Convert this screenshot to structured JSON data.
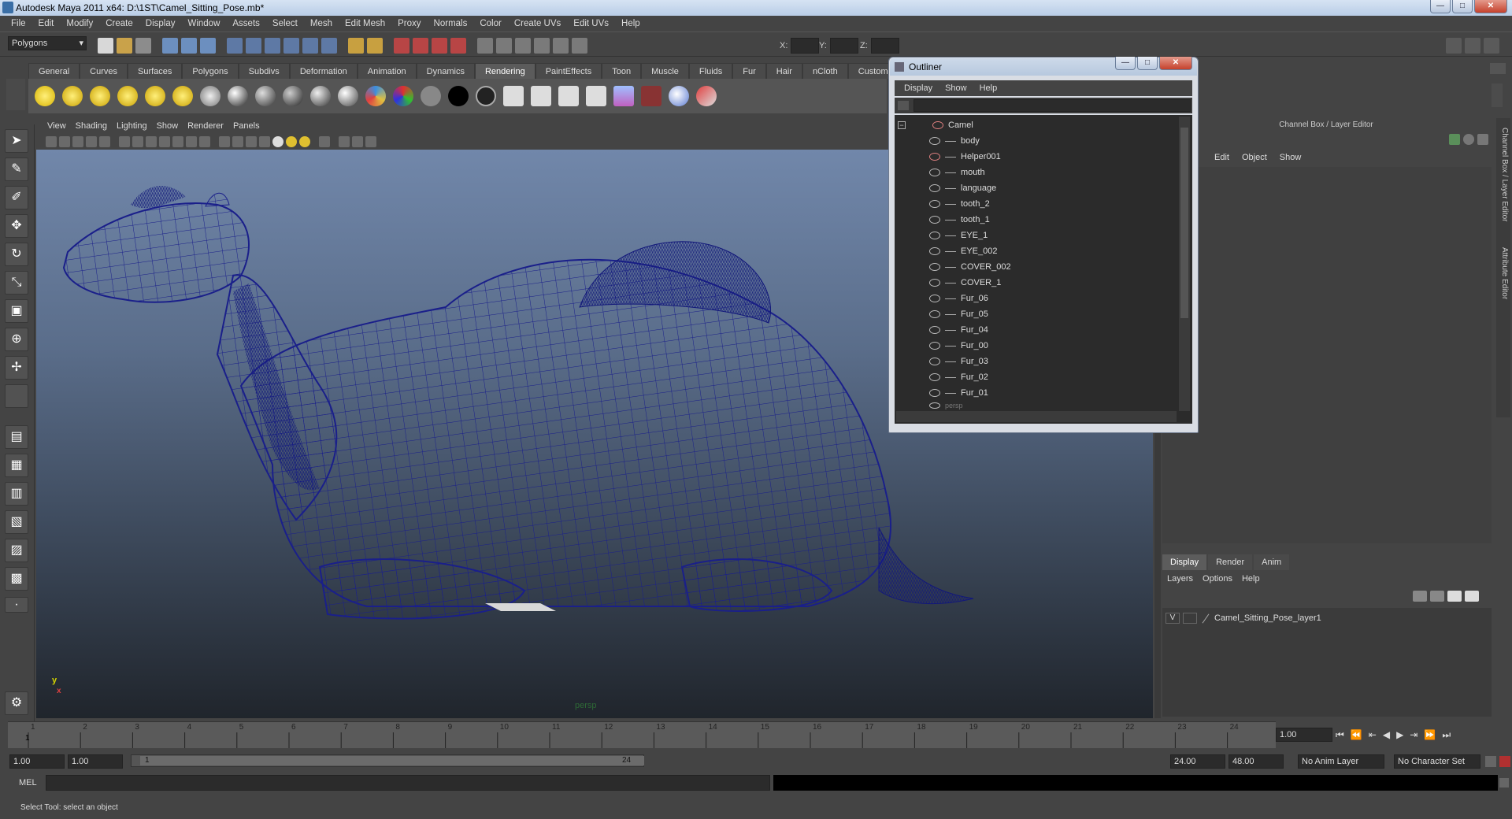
{
  "window": {
    "title": "Autodesk Maya 2011 x64: D:\\1ST\\Camel_Sitting_Pose.mb*"
  },
  "menus": [
    "File",
    "Edit",
    "Modify",
    "Create",
    "Display",
    "Window",
    "Assets",
    "Select",
    "Mesh",
    "Edit Mesh",
    "Proxy",
    "Normals",
    "Color",
    "Create UVs",
    "Edit UVs",
    "Help"
  ],
  "statusline": {
    "mode": "Polygons",
    "x_label": "X:",
    "y_label": "Y:",
    "z_label": "Z:"
  },
  "shelf_tabs": [
    "General",
    "Curves",
    "Surfaces",
    "Polygons",
    "Subdivs",
    "Deformation",
    "Animation",
    "Dynamics",
    "Rendering",
    "PaintEffects",
    "Toon",
    "Muscle",
    "Fluids",
    "Fur",
    "Hair",
    "nCloth",
    "Custom"
  ],
  "active_shelf": "Rendering",
  "viewport": {
    "menus": [
      "View",
      "Shading",
      "Lighting",
      "Show",
      "Renderer",
      "Panels"
    ],
    "camera_label": "persp",
    "axis_y": "y",
    "axis_x": "x"
  },
  "outliner": {
    "title": "Outliner",
    "menus": [
      "Display",
      "Show",
      "Help"
    ],
    "items": [
      {
        "label": "Camel",
        "level": 0
      },
      {
        "label": "body",
        "level": 1
      },
      {
        "label": "Helper001",
        "level": 1
      },
      {
        "label": "mouth",
        "level": 1
      },
      {
        "label": "language",
        "level": 1
      },
      {
        "label": "tooth_2",
        "level": 1
      },
      {
        "label": "tooth_1",
        "level": 1
      },
      {
        "label": "EYE_1",
        "level": 1
      },
      {
        "label": "EYE_002",
        "level": 1
      },
      {
        "label": "COVER_002",
        "level": 1
      },
      {
        "label": "COVER_1",
        "level": 1
      },
      {
        "label": "Fur_06",
        "level": 1
      },
      {
        "label": "Fur_05",
        "level": 1
      },
      {
        "label": "Fur_04",
        "level": 1
      },
      {
        "label": "Fur_00",
        "level": 1
      },
      {
        "label": "Fur_03",
        "level": 1
      },
      {
        "label": "Fur_02",
        "level": 1
      },
      {
        "label": "Fur_01",
        "level": 1
      },
      {
        "label": "persp",
        "level": 0
      }
    ]
  },
  "channel_box": {
    "header": "Channel Box / Layer Editor",
    "menus": [
      "Edit",
      "Object",
      "Show"
    ],
    "side_tab_1": "Channel Box / Layer Editor",
    "side_tab_2": "Attribute Editor"
  },
  "layer_editor": {
    "tabs": [
      "Display",
      "Render",
      "Anim"
    ],
    "active_tab": "Display",
    "menus": [
      "Layers",
      "Options",
      "Help"
    ],
    "layers": [
      {
        "visible": "V",
        "name": "Camel_Sitting_Pose_layer1"
      }
    ]
  },
  "timeline": {
    "ticks": [
      "1",
      "2",
      "3",
      "4",
      "5",
      "6",
      "7",
      "8",
      "9",
      "10",
      "11",
      "12",
      "13",
      "14",
      "15",
      "16",
      "17",
      "18",
      "19",
      "20",
      "21",
      "22",
      "23",
      "24"
    ],
    "current_frame": "1",
    "current_time_field": "1.00"
  },
  "range": {
    "start_time": "1.00",
    "playback_start": "1.00",
    "range_start_label": "1",
    "range_end_label": "24",
    "playback_end": "24.00",
    "end_time": "48.00",
    "anim_layer": "No Anim Layer",
    "character_set": "No Character Set"
  },
  "command_line": {
    "label": "MEL"
  },
  "help_line": "Select Tool: select an object"
}
